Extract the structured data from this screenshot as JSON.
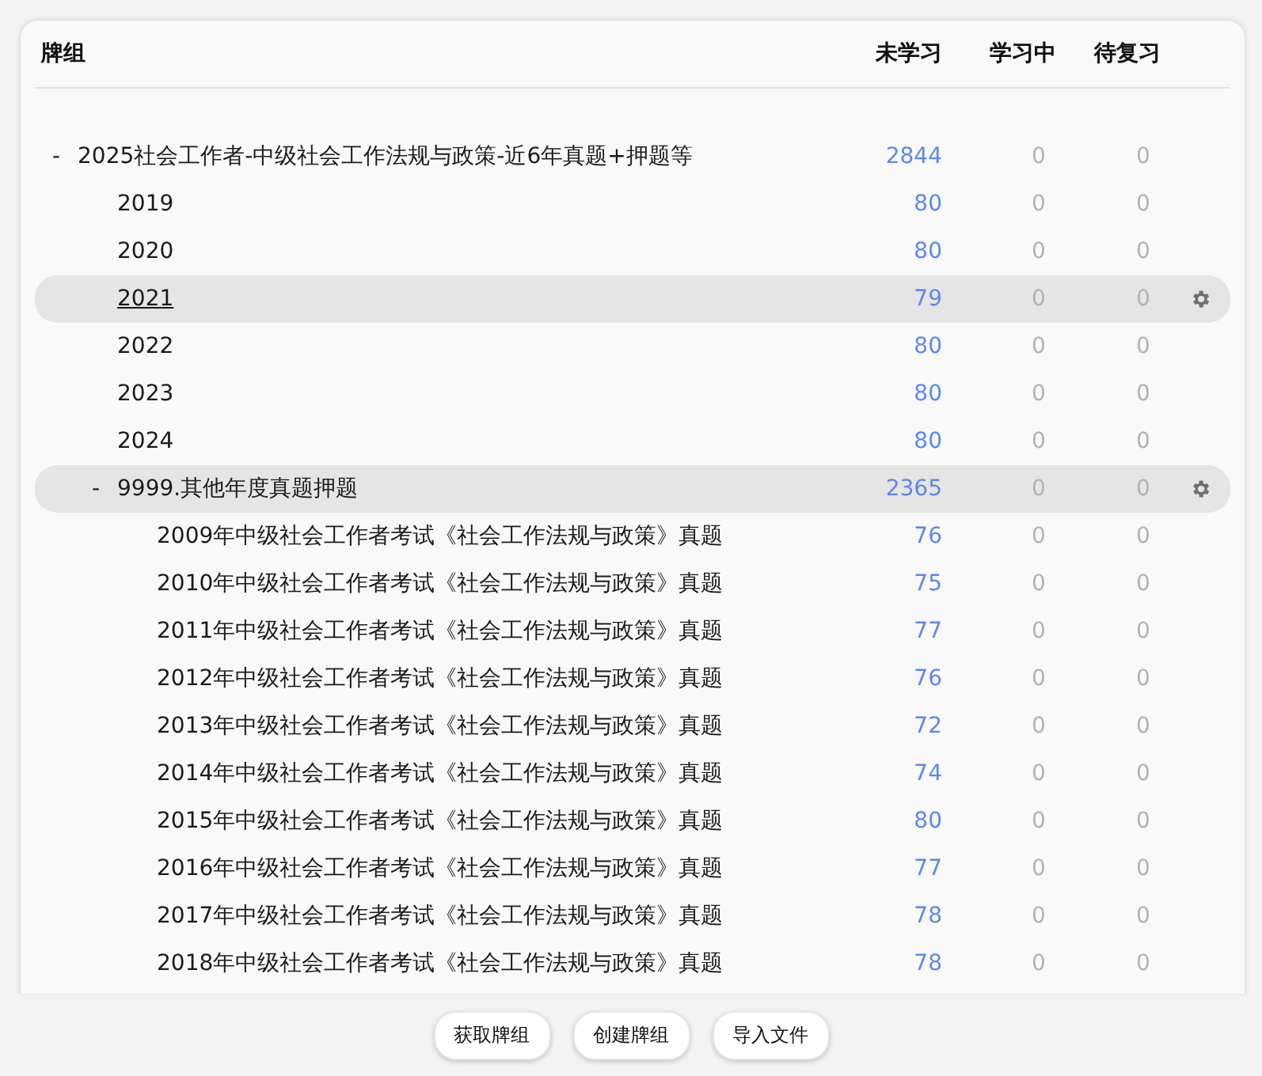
{
  "columns": [
    "牌组",
    "未学习",
    "学习中",
    "待复习"
  ],
  "decks": [
    {
      "name": "2025社会工作者-中级社会工作法规与政策-近6年真题+押题等",
      "toggle": "-",
      "highlighted": false,
      "current": false,
      "new": "2844",
      "learn": "0",
      "due": "0",
      "children": [
        {
          "name": "2019",
          "highlighted": false,
          "current": false,
          "new": "80",
          "learn": "0",
          "due": "0"
        },
        {
          "name": "2020",
          "highlighted": false,
          "current": false,
          "new": "80",
          "learn": "0",
          "due": "0"
        },
        {
          "name": "2021",
          "highlighted": true,
          "current": true,
          "new": "79",
          "learn": "0",
          "due": "0"
        },
        {
          "name": "2022",
          "highlighted": false,
          "current": false,
          "new": "80",
          "learn": "0",
          "due": "0"
        },
        {
          "name": "2023",
          "highlighted": false,
          "current": false,
          "new": "80",
          "learn": "0",
          "due": "0"
        },
        {
          "name": "2024",
          "highlighted": false,
          "current": false,
          "new": "80",
          "learn": "0",
          "due": "0"
        },
        {
          "name": "9999.其他年度真题押题",
          "toggle": "-",
          "highlighted": true,
          "current": false,
          "new": "2365",
          "learn": "0",
          "due": "0",
          "children": [
            {
              "name": "2009年中级社会工作者考试《社会工作法规与政策》真题",
              "highlighted": false,
              "current": false,
              "new": "76",
              "learn": "0",
              "due": "0"
            },
            {
              "name": "2010年中级社会工作者考试《社会工作法规与政策》真题",
              "highlighted": false,
              "current": false,
              "new": "75",
              "learn": "0",
              "due": "0"
            },
            {
              "name": "2011年中级社会工作者考试《社会工作法规与政策》真题",
              "highlighted": false,
              "current": false,
              "new": "77",
              "learn": "0",
              "due": "0"
            },
            {
              "name": "2012年中级社会工作者考试《社会工作法规与政策》真题",
              "highlighted": false,
              "current": false,
              "new": "76",
              "learn": "0",
              "due": "0"
            },
            {
              "name": "2013年中级社会工作者考试《社会工作法规与政策》真题",
              "highlighted": false,
              "current": false,
              "new": "72",
              "learn": "0",
              "due": "0"
            },
            {
              "name": "2014年中级社会工作者考试《社会工作法规与政策》真题",
              "highlighted": false,
              "current": false,
              "new": "74",
              "learn": "0",
              "due": "0"
            },
            {
              "name": "2015年中级社会工作者考试《社会工作法规与政策》真题",
              "highlighted": false,
              "current": false,
              "new": "80",
              "learn": "0",
              "due": "0"
            },
            {
              "name": "2016年中级社会工作者考试《社会工作法规与政策》真题",
              "highlighted": false,
              "current": false,
              "new": "77",
              "learn": "0",
              "due": "0"
            },
            {
              "name": "2017年中级社会工作者考试《社会工作法规与政策》真题",
              "highlighted": false,
              "current": false,
              "new": "78",
              "learn": "0",
              "due": "0"
            },
            {
              "name": "2018年中级社会工作者考试《社会工作法规与政策》真题",
              "highlighted": false,
              "current": false,
              "new": "78",
              "learn": "0",
              "due": "0"
            }
          ]
        }
      ]
    }
  ],
  "buttons": [
    "获取牌组",
    "创建牌组",
    "导入文件"
  ]
}
